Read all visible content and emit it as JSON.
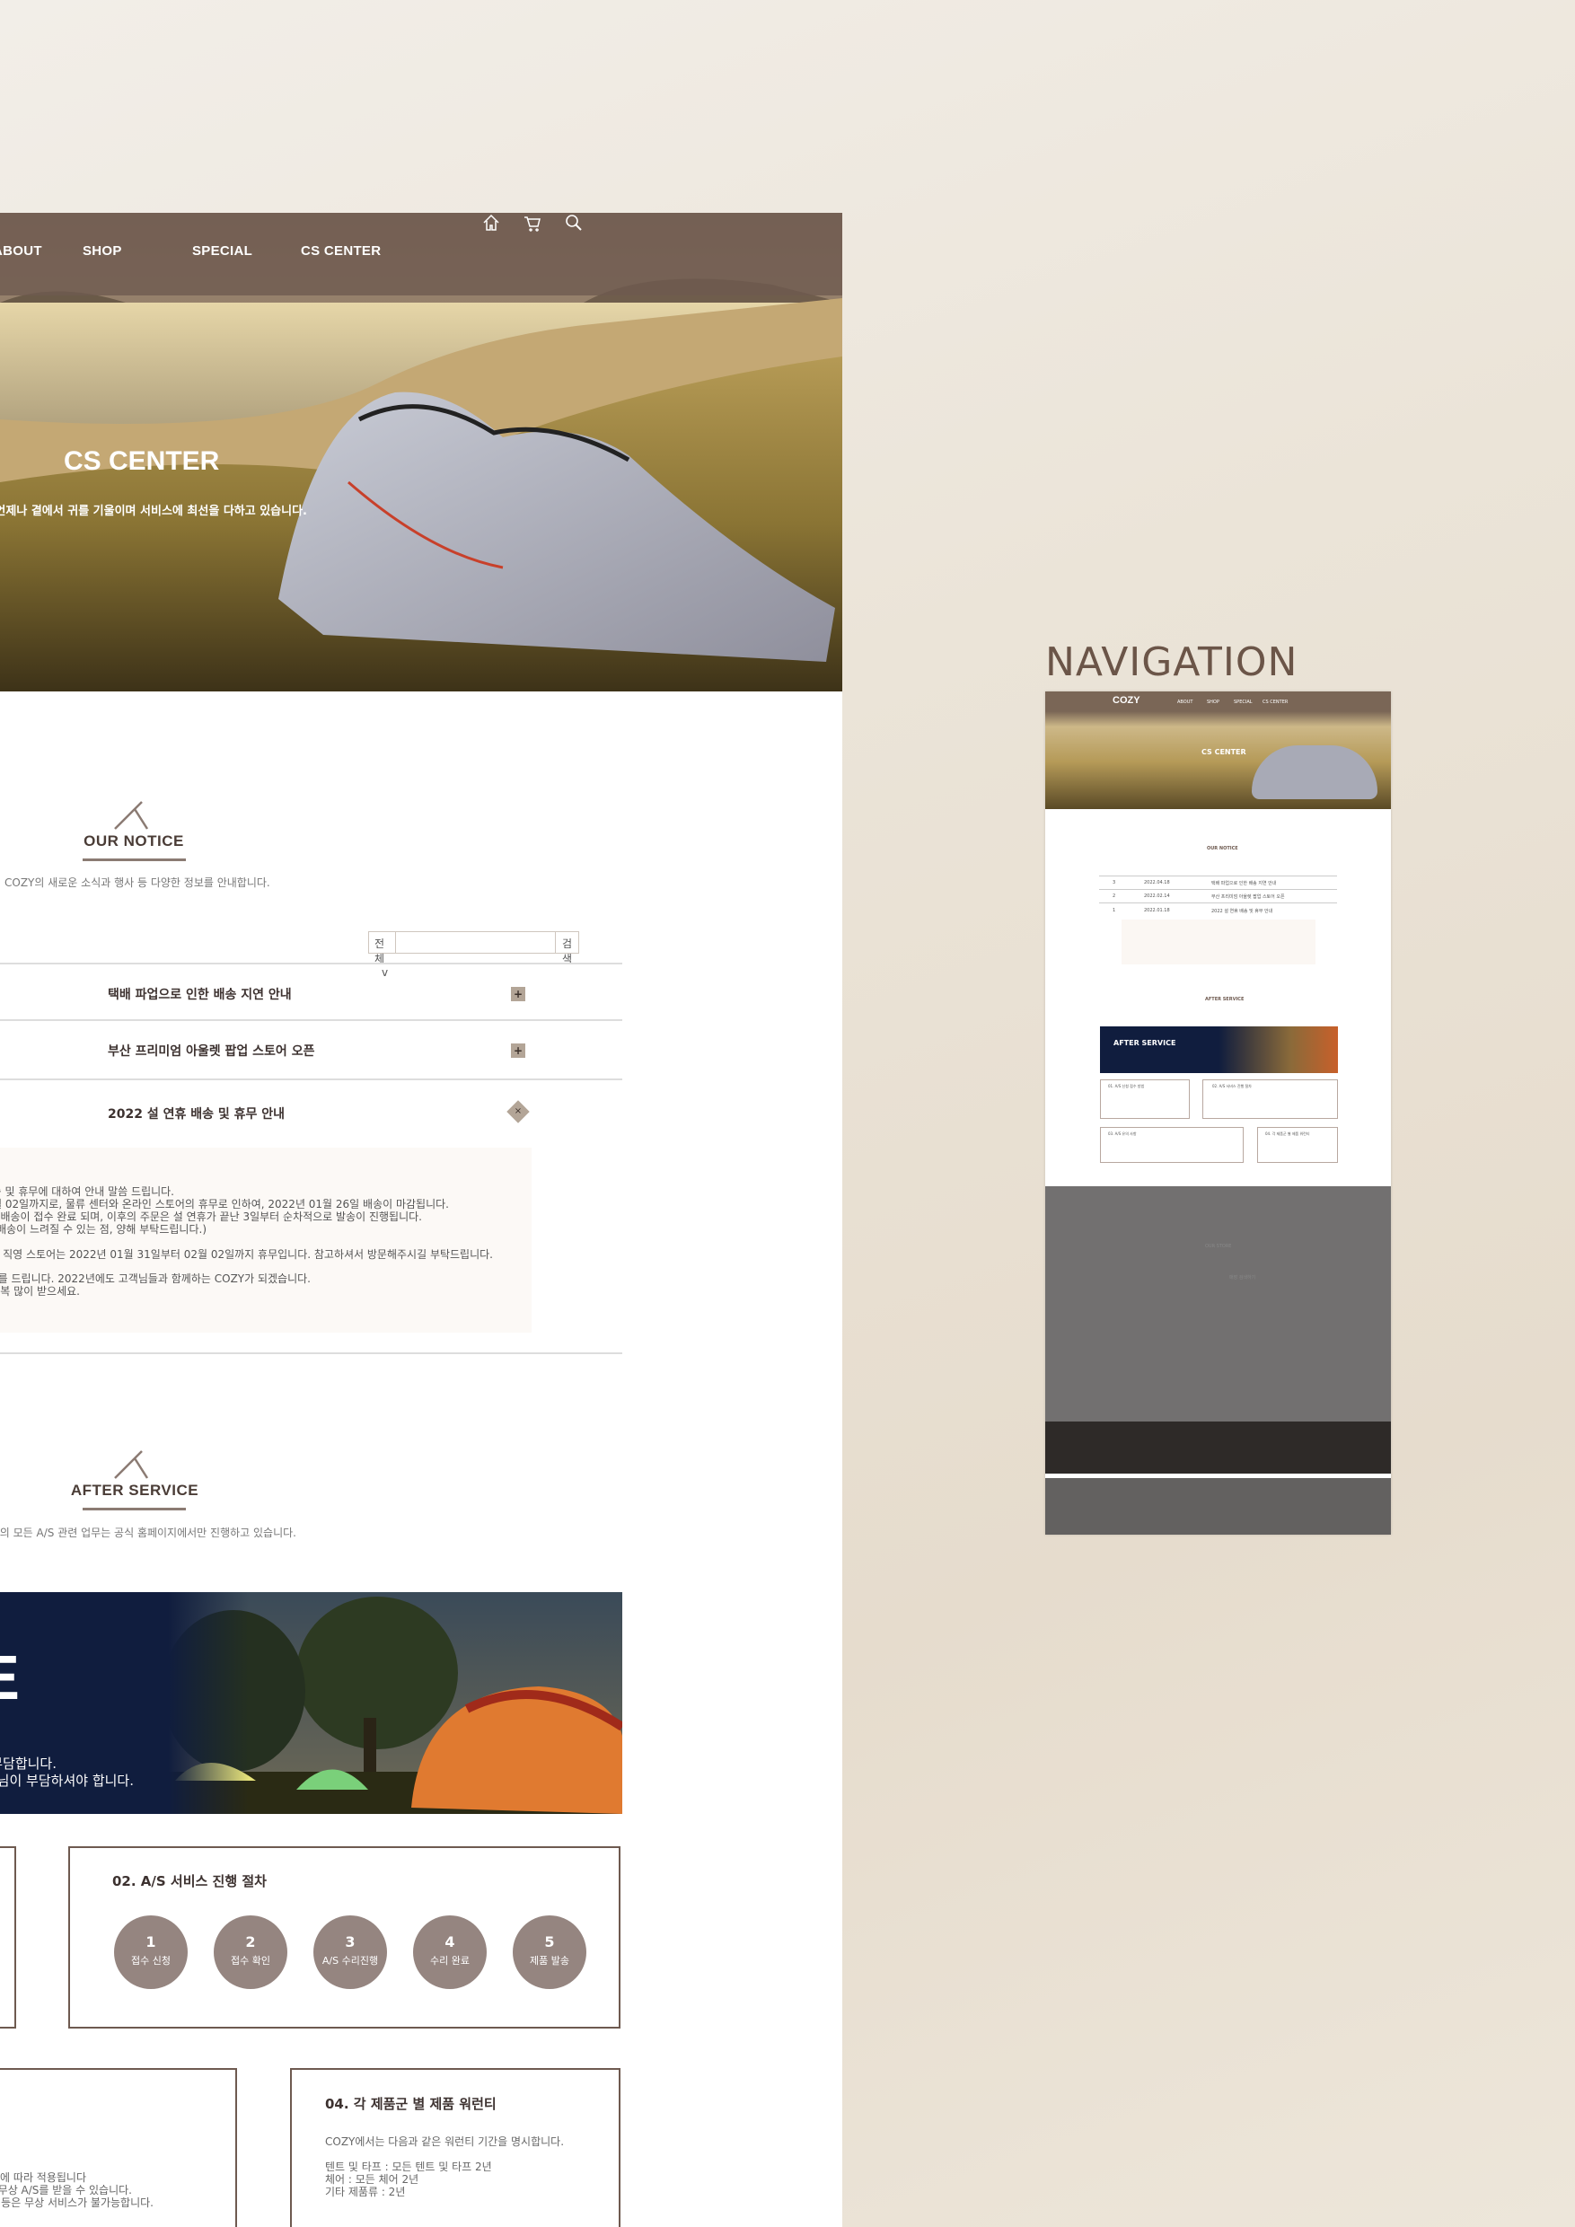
{
  "nav": {
    "items": [
      "ABOUT",
      "SHOP",
      "SPECIAL",
      "CS CENTER"
    ],
    "icons": [
      "home-icon",
      "cart-icon",
      "search-icon"
    ]
  },
  "hero": {
    "title": "CS CENTER",
    "subtitle": "COZY는 언제나 곁에서 귀를 기울이며 서비스에 최선을 다하고 있습니다."
  },
  "notice": {
    "title": "OUR NOTICE",
    "description": "COZY의 새로운 소식과 행사 등 다양한 정보를 안내합니다.",
    "search": {
      "select": "전체",
      "chevron": "v",
      "button": "검색",
      "value": ""
    },
    "rows": [
      {
        "title": "택배 파업으로 인한 배송 지연 안내",
        "toggle": "+"
      },
      {
        "title": "부산 프리미엄 아울렛 팝업 스토어 오픈",
        "toggle": "+"
      },
      {
        "title": "2022 설 연휴 배송 및 휴무 안내",
        "toggle": "×"
      }
    ],
    "content_lines": [
      "송 및 휴무에 대하여 안내 말씀 드립니다.",
      "월 02일까지로, 물류 센터와 온라인 스토어의 휴무로 인하여, 2022년 01월 26일 배송이 마감됩니다.",
      " 배송이 접수 완료 되며, 이후의 주문은 설 연휴가 끝난 3일부터 순차적으로 발송이 진행됩니다.",
      "배송이 느려질 수 있는 점, 양해 부탁드립니다.)",
      "의 직영 스토어는 2022년 01월 31일부터 02월 02일까지 휴무입니다. 참고하셔서 방문해주시길 부탁드립니다.",
      "사를 드립니다. 2022년에도 고객님들과 함께하는 COZY가 되겠습니다.",
      "복 많이 받으세요."
    ]
  },
  "after_service": {
    "title": "AFTER SERVICE",
    "description": "Y의 모든 A/S 관련 업무는 공식 홈페이지에서만 진행하고 있습니다.",
    "banner": {
      "title": "AFTER SERVICE",
      "lines": [
        "품질 보증 대상은 당사가 부담합니다.",
        "단, 유상 수리 대상은 고객님이 부담하셔야 합니다."
      ]
    },
    "process": {
      "title": "02. A/S 서비스 진행 절차",
      "steps": [
        {
          "n": "1",
          "label": "접수 신청"
        },
        {
          "n": "2",
          "label": "접수 확인"
        },
        {
          "n": "3",
          "label": "A/S 수리진행"
        },
        {
          "n": "4",
          "label": "수리 완료"
        },
        {
          "n": "5",
          "label": "제품 발송"
        }
      ]
    },
    "notes_lines": [
      "티 기간에 따라 적용됩니다",
      "한 순서로 무상 A/S를 받을 수 있습니다.",
      "의적인 수리 등은 무상 서비스가 불가능합니다."
    ],
    "warranty": {
      "title": "04. 각 제품군 별 제품 워런티",
      "intro": "COZY에서는 다음과 같은 워런티 기간을 명시합니다.",
      "lines": [
        "텐트 및 타프 : 모든 텐트 및 타프 2년",
        "체어 : 모든 체어 2년",
        "기타 제품류 : 2년"
      ]
    }
  },
  "navigation_preview": {
    "label": "NAVIGATION",
    "logo": "COZY",
    "nav": [
      "ABOUT",
      "SHOP",
      "SPECIAL",
      "CS CENTER"
    ],
    "hero_title": "CS CENTER",
    "notice_title": "OUR NOTICE",
    "rows": [
      {
        "no": "3",
        "date": "2022.04.18",
        "title": "택배 파업으로 인한 배송 지연 안내"
      },
      {
        "no": "2",
        "date": "2022.02.14",
        "title": "부산 프리미엄 아울렛 팝업 스토어 오픈"
      },
      {
        "no": "1",
        "date": "2022.01.18",
        "title": "2022 설 연휴 배송 및 휴무 안내"
      }
    ],
    "after_title": "AFTER SERVICE",
    "banner_title": "AFTER SERVICE",
    "box_titles": [
      "01. A/S 신청 접수 방법",
      "02. A/S 서비스 진행 절차",
      "03. A/S 유의 사항",
      "04. 각 제품군 별 제품 워런티"
    ],
    "store_title": "OUR STORE",
    "store_search": "매장 검색하기"
  },
  "colors": {
    "brand": "#6e5a50",
    "circle": "#958580",
    "banner": "#101d3e",
    "content_bg": "#fcf9f6"
  }
}
